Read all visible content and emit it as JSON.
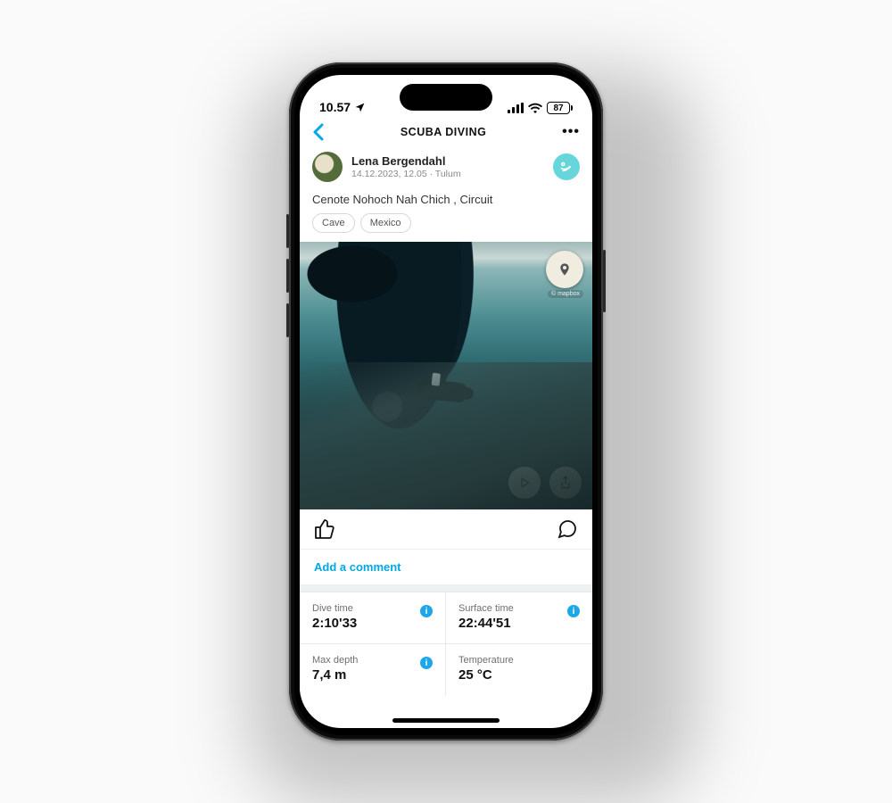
{
  "status": {
    "time": "10.57",
    "battery": "87"
  },
  "nav": {
    "title": "SCUBA DIVING"
  },
  "post": {
    "author": "Lena Bergendahl",
    "meta": "14.12.2023, 12.05 · Tulum",
    "title": "Cenote Nohoch Nah Chich , Circuit",
    "tags": [
      "Cave",
      "Mexico"
    ],
    "map_attr": "© mapbox"
  },
  "actions": {
    "comment_prompt": "Add a comment"
  },
  "stats": [
    {
      "label": "Dive time",
      "value": "2:10'33"
    },
    {
      "label": "Surface time",
      "value": "22:44'51"
    },
    {
      "label": "Max depth",
      "value": "7,4 m"
    },
    {
      "label": "Temperature",
      "value": "25 °C"
    }
  ]
}
